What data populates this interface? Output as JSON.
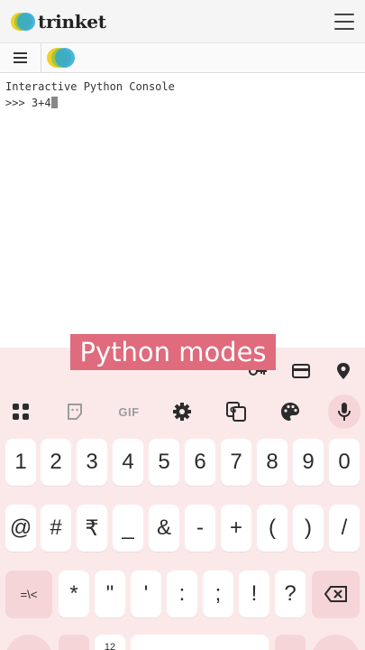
{
  "header": {
    "brand": "trinket"
  },
  "console": {
    "lines": [
      "Interactive Python Console",
      ">>> 3+4"
    ]
  },
  "caption": "Python modes",
  "keyboard": {
    "suggestion_icons": [
      "key-icon",
      "card-icon",
      "location-pin-icon"
    ],
    "tools": [
      "apps-grid-icon",
      "sticker-icon",
      "GIF",
      "settings-gear-icon",
      "translate-icon",
      "palette-icon",
      "mic-icon"
    ],
    "row_numbers": [
      "1",
      "2",
      "3",
      "4",
      "5",
      "6",
      "7",
      "8",
      "9",
      "0"
    ],
    "row_symbols": [
      "@",
      "#",
      "₹",
      "_",
      "&",
      "-",
      "+",
      "(",
      ")",
      "/"
    ],
    "row_more": [
      "=\\<",
      "*",
      "\"",
      "'",
      ":",
      ";",
      "!",
      "?"
    ],
    "bottom_partial": [
      "12"
    ]
  },
  "colors": {
    "keyboard_bg": "#fbe9ea",
    "accent_key": "#f6d5d8",
    "caption_bg": "#df6b7c"
  }
}
